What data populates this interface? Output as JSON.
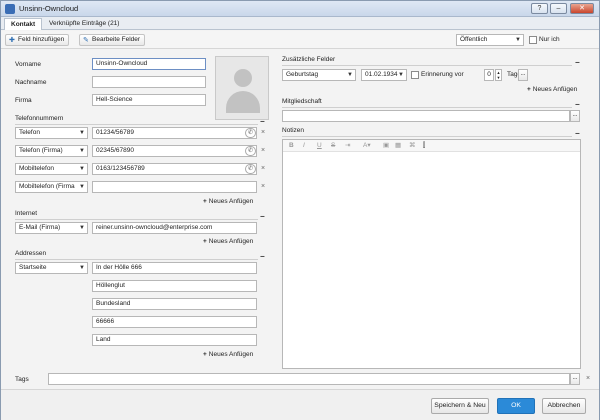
{
  "window": {
    "title": "Unsinn-Owncloud"
  },
  "tabs": [
    {
      "label": "Kontakt"
    },
    {
      "label": "Verknüpfte Einträge (21)"
    }
  ],
  "toolbar": {
    "add_field": "Feld hinzufügen",
    "edit_fields": "Bearbeite Felder",
    "visibility": "Öffentlich",
    "only_me": "Nur ich"
  },
  "contact": {
    "first_name_label": "Vorname",
    "first_name": "Unsinn-Owncloud",
    "last_name_label": "Nachname",
    "last_name": "",
    "company_label": "Firma",
    "company": "Hell-Science"
  },
  "phones": {
    "title": "Telefonnummern",
    "rows": [
      {
        "type": "Telefon",
        "value": "01234/56789"
      },
      {
        "type": "Telefon (Firma)",
        "value": "02345/67890"
      },
      {
        "type": "Mobiltelefon",
        "value": "0163/123456789"
      },
      {
        "type": "Mobiltelefon (Firma",
        "value": ""
      }
    ],
    "add": "Neues Anfügen"
  },
  "internet": {
    "title": "Internet",
    "type": "E-Mail (Firma)",
    "value": "reiner.unsinn-owncloud@enterprise.com",
    "add": "Neues Anfügen"
  },
  "addresses": {
    "title": "Addressen",
    "type": "Startseite",
    "street": "In der Hölle 666",
    "city": "Höllenglut",
    "state": "Bundesland",
    "zip": "66666",
    "country": "Land",
    "add": "Neues Anfügen"
  },
  "extra": {
    "title": "Zusätzliche Felder",
    "field_type": "Geburtstag",
    "date": "01.02.1934",
    "reminder_label": "Erinnerung vor",
    "reminder_value": "0",
    "days_label": "Tage",
    "more": "...",
    "add": "Neues Anfügen"
  },
  "membership": {
    "title": "Mitgliedschaft",
    "value": "",
    "more": "..."
  },
  "notes": {
    "title": "Notizen",
    "text": ""
  },
  "tags": {
    "label": "Tags",
    "value": "",
    "more": "..."
  },
  "buttons": {
    "save_new": "Speichern & Neu",
    "ok": "OK",
    "cancel": "Abbrechen"
  },
  "colors": {
    "primary": "#2b8ad8",
    "title_bar": "#c9d7ea"
  },
  "icons": {
    "app": "contact-card-icon",
    "add_field": "plus-icon",
    "edit_fields": "pencil-icon",
    "photo": "person-silhouette-icon",
    "phone": "phone-icon",
    "remove": "close-icon"
  }
}
